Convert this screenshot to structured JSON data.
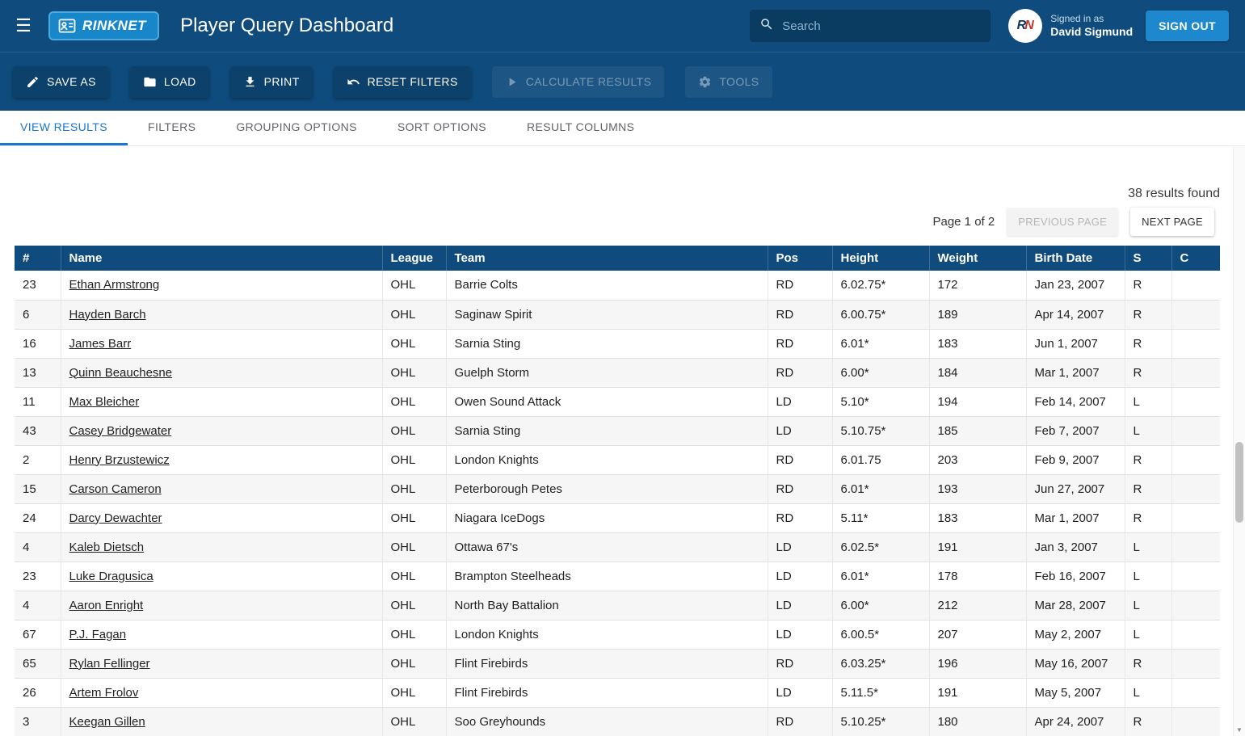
{
  "navbar": {
    "brand": "RINKNET",
    "title": "Player Query Dashboard",
    "search_placeholder": "Search",
    "signed_in_label": "Signed in as",
    "user_name": "David Sigmund",
    "sign_out_label": "SIGN OUT"
  },
  "toolbar": {
    "save_as": "SAVE AS",
    "load": "LOAD",
    "print": "PRINT",
    "reset_filters": "RESET FILTERS",
    "calculate_results": "CALCULATE RESULTS",
    "tools": "TOOLS"
  },
  "tabs": [
    {
      "label": "VIEW RESULTS",
      "active": true
    },
    {
      "label": "FILTERS",
      "active": false
    },
    {
      "label": "GROUPING OPTIONS",
      "active": false
    },
    {
      "label": "SORT OPTIONS",
      "active": false
    },
    {
      "label": "RESULT COLUMNS",
      "active": false
    }
  ],
  "results": {
    "summary": "38 results found",
    "page_label": "Page 1 of 2",
    "previous_label": "PREVIOUS PAGE",
    "next_label": "NEXT PAGE"
  },
  "table": {
    "columns": [
      "#",
      "Name",
      "League",
      "Team",
      "Pos",
      "Height",
      "Weight",
      "Birth Date",
      "S",
      "C"
    ],
    "column_keys": [
      "number",
      "name",
      "league",
      "team",
      "pos",
      "height",
      "weight",
      "birth-date",
      "shoots",
      "c"
    ],
    "rows": [
      [
        "23",
        "Ethan Armstrong",
        "OHL",
        "Barrie Colts",
        "RD",
        "6.02.75*",
        "172",
        "Jan 23, 2007",
        "R",
        ""
      ],
      [
        "6",
        "Hayden Barch",
        "OHL",
        "Saginaw Spirit",
        "RD",
        "6.00.75*",
        "189",
        "Apr 14, 2007",
        "R",
        ""
      ],
      [
        "16",
        "James Barr",
        "OHL",
        "Sarnia Sting",
        "RD",
        "6.01*",
        "183",
        "Jun 1, 2007",
        "R",
        ""
      ],
      [
        "13",
        "Quinn Beauchesne",
        "OHL",
        "Guelph Storm",
        "RD",
        "6.00*",
        "184",
        "Mar 1, 2007",
        "R",
        ""
      ],
      [
        "11",
        "Max Bleicher",
        "OHL",
        "Owen Sound Attack",
        "LD",
        "5.10*",
        "194",
        "Feb 14, 2007",
        "L",
        ""
      ],
      [
        "43",
        "Casey Bridgewater",
        "OHL",
        "Sarnia Sting",
        "LD",
        "5.10.75*",
        "185",
        "Feb 7, 2007",
        "L",
        ""
      ],
      [
        "2",
        "Henry Brzustewicz",
        "OHL",
        "London Knights",
        "RD",
        "6.01.75",
        "203",
        "Feb 9, 2007",
        "R",
        ""
      ],
      [
        "15",
        "Carson Cameron",
        "OHL",
        "Peterborough Petes",
        "RD",
        "6.01*",
        "193",
        "Jun 27, 2007",
        "R",
        ""
      ],
      [
        "24",
        "Darcy Dewachter",
        "OHL",
        "Niagara IceDogs",
        "RD",
        "5.11*",
        "183",
        "Mar 1, 2007",
        "R",
        ""
      ],
      [
        "4",
        "Kaleb Dietsch",
        "OHL",
        "Ottawa 67's",
        "LD",
        "6.02.5*",
        "191",
        "Jan 3, 2007",
        "L",
        ""
      ],
      [
        "23",
        "Luke Dragusica",
        "OHL",
        "Brampton Steelheads",
        "LD",
        "6.01*",
        "178",
        "Feb 16, 2007",
        "L",
        ""
      ],
      [
        "4",
        "Aaron Enright",
        "OHL",
        "North Bay Battalion",
        "LD",
        "6.00*",
        "212",
        "Mar 28, 2007",
        "L",
        ""
      ],
      [
        "67",
        "P.J. Fagan",
        "OHL",
        "London Knights",
        "LD",
        "6.00.5*",
        "207",
        "May 2, 2007",
        "L",
        ""
      ],
      [
        "65",
        "Rylan Fellinger",
        "OHL",
        "Flint Firebirds",
        "RD",
        "6.03.25*",
        "196",
        "May 16, 2007",
        "R",
        ""
      ],
      [
        "26",
        "Artem Frolov",
        "OHL",
        "Flint Firebirds",
        "LD",
        "5.11.5*",
        "191",
        "May 5, 2007",
        "L",
        ""
      ],
      [
        "3",
        "Keegan Gillen",
        "OHL",
        "Soo Greyhounds",
        "RD",
        "5.10.25*",
        "180",
        "Apr 24, 2007",
        "R",
        ""
      ]
    ]
  },
  "colors": {
    "navbar_bg": "#0f4c7d",
    "brand_bg": "#1787c9",
    "accent_button": "#1e88cf",
    "tab_active": "#1976d2",
    "table_header_bg": "#0f4c7d",
    "row_alt_bg": "#f6f6f6"
  }
}
